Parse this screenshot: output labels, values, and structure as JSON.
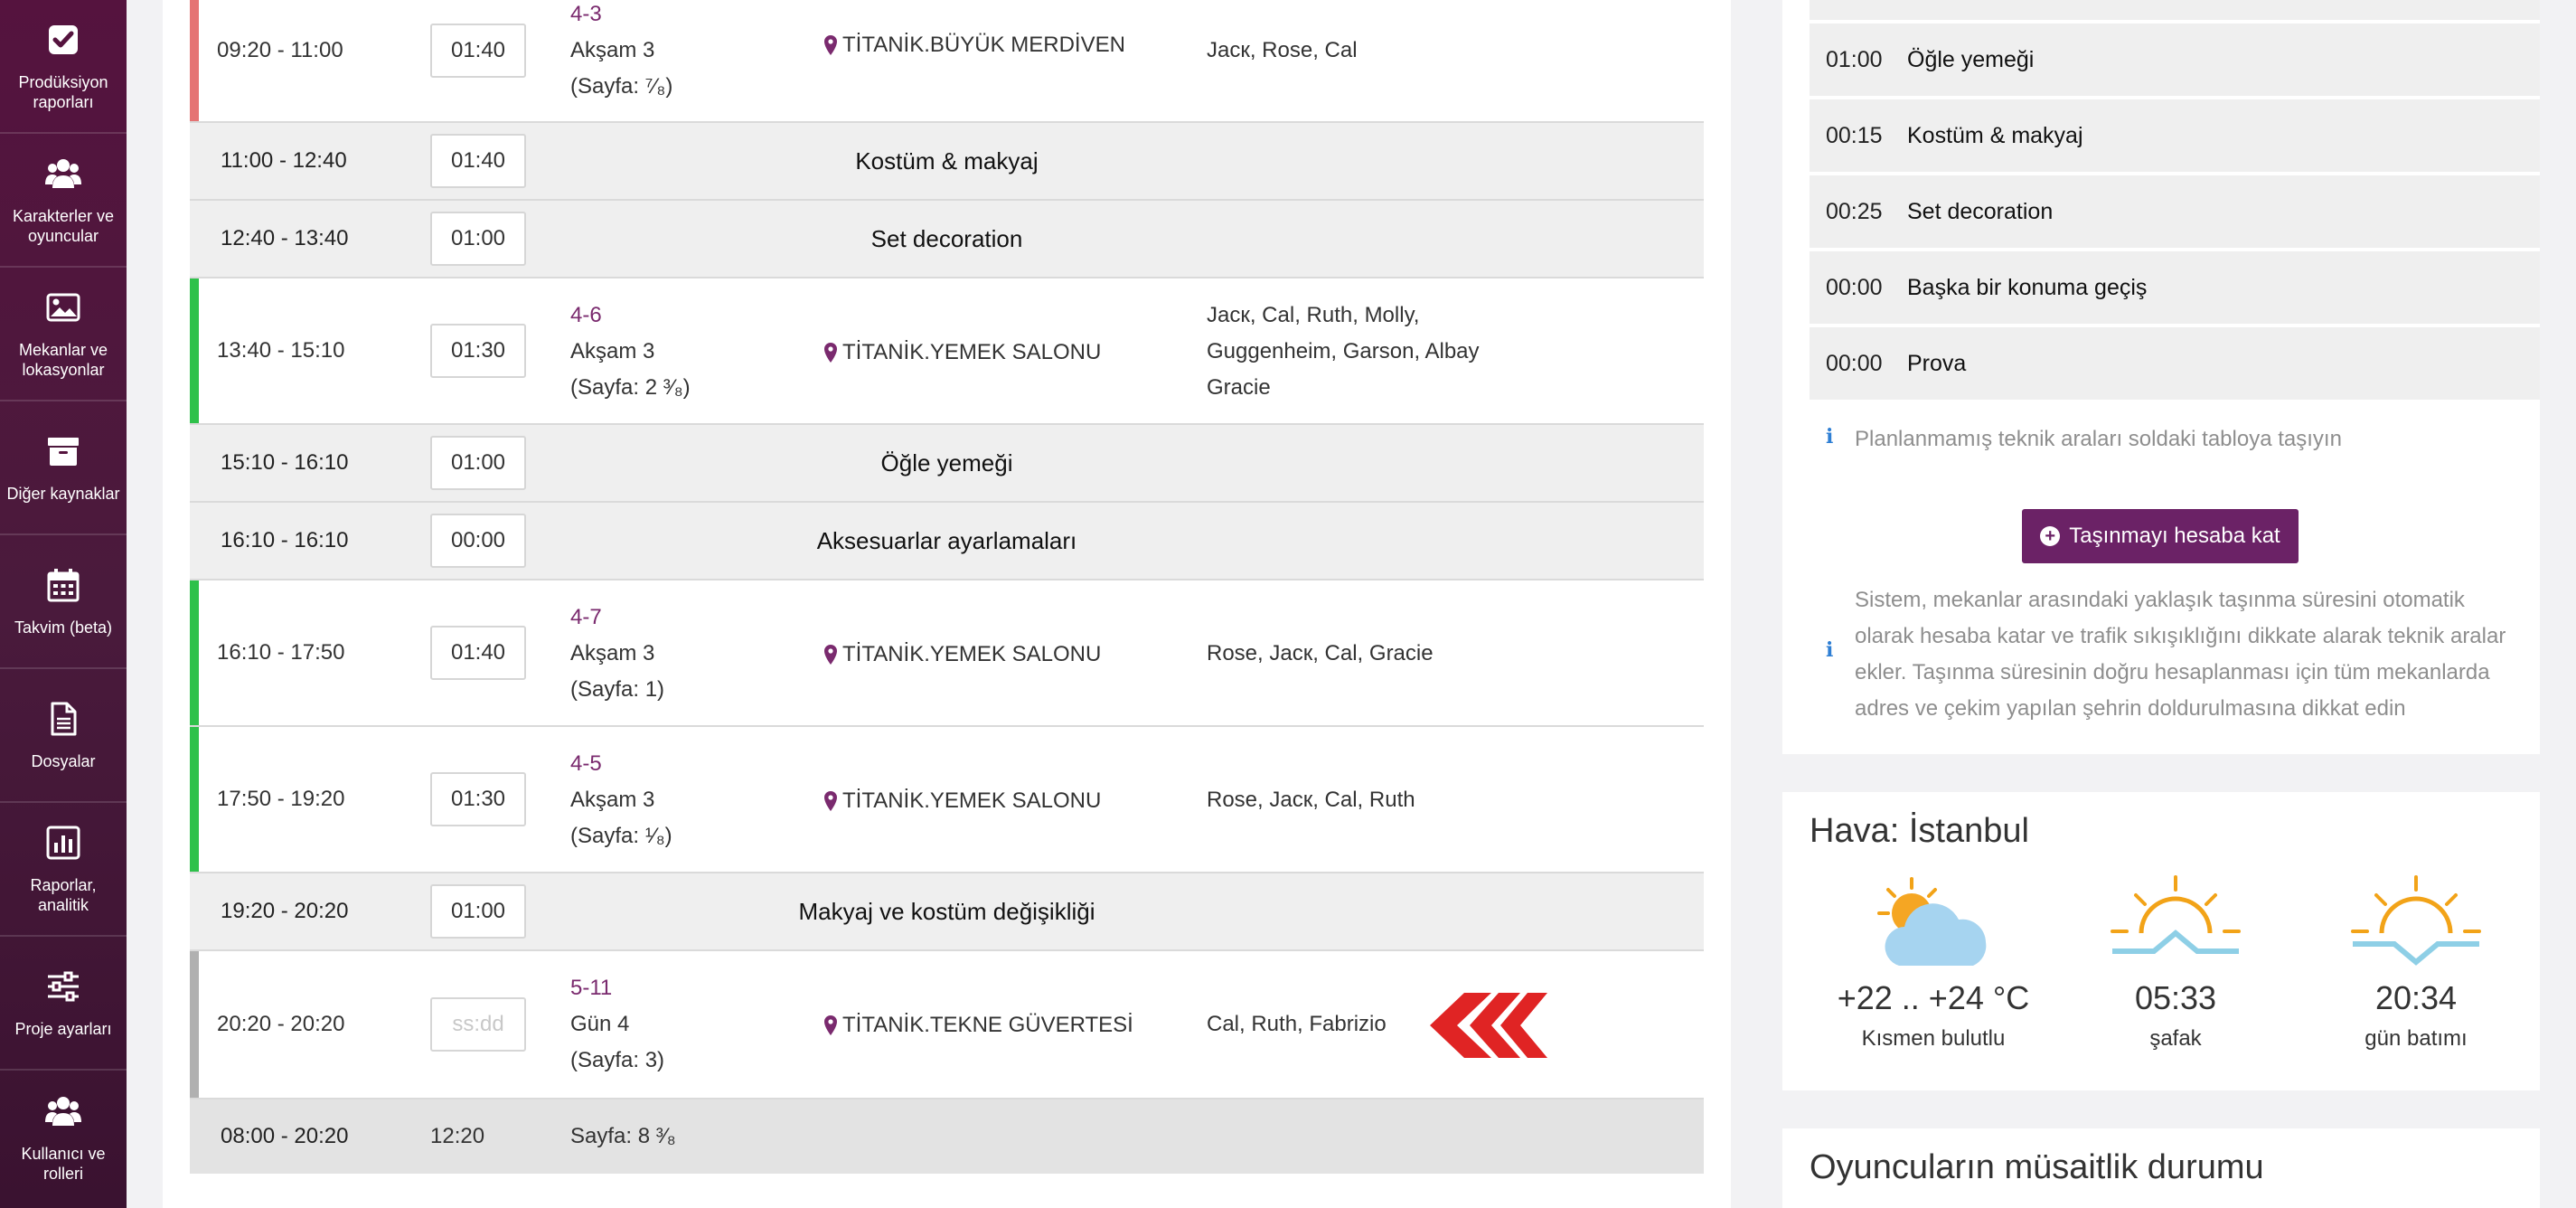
{
  "sidebar": {
    "items": [
      {
        "label": "Prodüksiyon raporları",
        "icon": "checkbox-icon"
      },
      {
        "label": "Karakterler ve oyuncular",
        "icon": "users-icon"
      },
      {
        "label": "Mekanlar ve lokasyonlar",
        "icon": "image-icon"
      },
      {
        "label": "Diğer kaynaklar",
        "icon": "archive-icon"
      },
      {
        "label": "Takvim (beta)",
        "icon": "calendar-icon"
      },
      {
        "label": "Dosyalar",
        "icon": "file-icon"
      },
      {
        "label": "Raporlar, analitik",
        "icon": "bar-chart-icon"
      },
      {
        "label": "Proje ayarları",
        "icon": "sliders-icon"
      },
      {
        "label": "Kullanıcı ve rolleri",
        "icon": "users-icon"
      }
    ]
  },
  "schedule": {
    "rows": [
      {
        "type": "scene",
        "time": "09:20 - 11:00",
        "duration": "01:40",
        "scene": "4-3",
        "day": "Akşam 3",
        "page": "(Sayfa: ⁷⁄₈)",
        "location": "TİTANİK.BÜYÜK MERDİVEN",
        "cast": "Jacк, Rose, Cal",
        "bar_color": "#e57373"
      },
      {
        "type": "break",
        "time": "11:00 - 12:40",
        "duration": "01:40",
        "title": "Kostüm & makyaj"
      },
      {
        "type": "break",
        "time": "12:40 - 13:40",
        "duration": "01:00",
        "title": "Set decoration"
      },
      {
        "type": "scene",
        "time": "13:40 - 15:10",
        "duration": "01:30",
        "scene": "4-6",
        "day": "Akşam 3",
        "page": "(Sayfa: 2 ³⁄₈)",
        "location": "TİTANİK.YEMEK SALONU",
        "cast": "Jacк, Cal, Ruth, Molly, Guggenheim, Garson, Albay Gracie",
        "bar_color": "#2ec14a"
      },
      {
        "type": "break",
        "time": "15:10 - 16:10",
        "duration": "01:00",
        "title": "Öğle yemeği"
      },
      {
        "type": "break",
        "time": "16:10 - 16:10",
        "duration": "00:00",
        "title": "Aksesuarlar ayarlamaları"
      },
      {
        "type": "scene",
        "time": "16:10 - 17:50",
        "duration": "01:40",
        "scene": "4-7",
        "day": "Akşam 3",
        "page": "(Sayfa: 1)",
        "location": "TİTANİK.YEMEK SALONU",
        "cast": "Rose, Jacк, Cal, Gracie",
        "bar_color": "#2ec14a"
      },
      {
        "type": "scene",
        "time": "17:50 - 19:20",
        "duration": "01:30",
        "scene": "4-5",
        "day": "Akşam 3",
        "page": "(Sayfa: ¹⁄₈)",
        "location": "TİTANİK.YEMEK SALONU",
        "cast": "Rose, Jacк, Cal, Ruth",
        "bar_color": "#2ec14a"
      },
      {
        "type": "break",
        "time": "19:20 - 20:20",
        "duration": "01:00",
        "title": "Makyaj ve kostüm değişikliği"
      },
      {
        "type": "scene",
        "time": "20:20 - 20:20",
        "duration_placeholder": "ss:dd",
        "scene": "5-11",
        "day": "Gün 4",
        "page": "(Sayfa: 3)",
        "location": "TİTANİK.TEKNE GÜVERTESİ",
        "cast": "Cal, Ruth, Fabrizio",
        "bar_color": "#b0b0b0"
      }
    ],
    "total": {
      "time": "08:00 - 20:20",
      "duration": "12:20",
      "pages": "Sayfa: 8 ³⁄₈"
    }
  },
  "tech_breaks": {
    "rows": [
      {
        "time": "01:00",
        "label": "Öğle yemeği"
      },
      {
        "time": "00:15",
        "label": "Kostüm & makyaj"
      },
      {
        "time": "00:25",
        "label": "Set decoration"
      },
      {
        "time": "00:00",
        "label": "Başka bir konuma geçiş"
      },
      {
        "time": "00:00",
        "label": "Prova"
      }
    ],
    "hint": "Planlanmamış teknik araları soldaki tabloya taşıyın",
    "button": "Taşınmayı hesaba kat",
    "info_lines": [
      "Sistem, mekanlar arasındaki yaklaşık taşınma süresini otomatik",
      "olarak hesaba katar ve trafik sıkışıklığını dikkate alarak teknik aralar",
      "ekler. Taşınma süresinin doğru hesaplanması için tüm mekanlarda",
      "adres ve çekim yapılan şehrin doldurulmasına dikkat edin"
    ]
  },
  "weather": {
    "title": "Hava: İstanbul",
    "items": [
      {
        "value": "+22 .. +24 °C",
        "label": "Kısmen bulutlu",
        "icon": "partly-cloudy-icon"
      },
      {
        "value": "05:33",
        "label": "şafak",
        "icon": "sunrise-icon"
      },
      {
        "value": "20:34",
        "label": "gün batımı",
        "icon": "sunset-icon"
      }
    ]
  },
  "availability": {
    "title": "Oyuncuların müsaitlik durumu"
  }
}
